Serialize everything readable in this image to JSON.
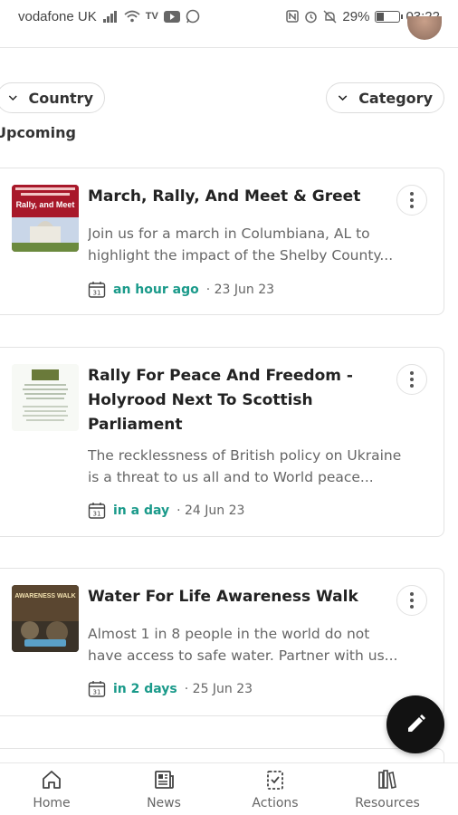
{
  "status_bar": {
    "carrier": "vodafone UK",
    "battery": "29%",
    "battery_level": 0.29,
    "time": "03:22"
  },
  "filters": {
    "country_label": "Country",
    "category_label": "Category"
  },
  "section": {
    "title": "Upcoming"
  },
  "events": [
    {
      "title": "March, Rally, And Meet & Greet",
      "description": "Join us for a march in Columbiana, AL to highlight the impact of the Shelby County...",
      "relative_time": "an hour ago",
      "date": "· 23 Jun 23",
      "thumb_caption": "Rally, and Meet"
    },
    {
      "title_line1": "Rally For Peace And Freedom -",
      "title_line2": "Holyrood Next To Scottish",
      "title_line3": "Parliament",
      "description_line1": "The recklessness of British policy on Ukraine",
      "description_line2": "is a threat to us all and to World peace...",
      "relative_time": "in a day",
      "date": "· 24 Jun 23"
    },
    {
      "title": "Water For Life Awareness Walk",
      "description_line1": "Almost 1 in 8 people in the world do not",
      "description_line2": "have access to safe water. Partner with us...",
      "relative_time": "in 2 days",
      "date": "· 25 Jun 23",
      "thumb_caption": "AWARENESS WALK"
    }
  ],
  "nav": {
    "home": "Home",
    "news": "News",
    "actions": "Actions",
    "resources": "Resources"
  },
  "icons": {
    "calendar_number": "31"
  },
  "colors": {
    "accent": "#1a9a8a",
    "fab": "#121212"
  }
}
